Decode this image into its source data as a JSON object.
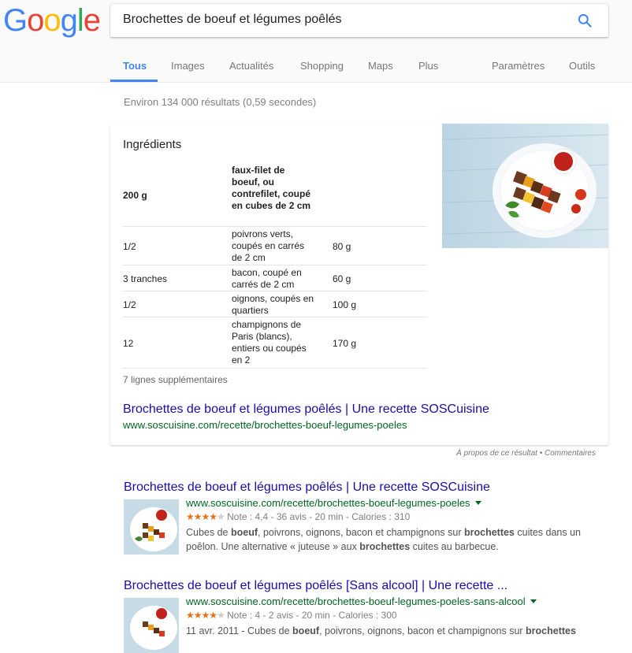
{
  "logo": {
    "letters": [
      "G",
      "o",
      "o",
      "g",
      "l",
      "e"
    ],
    "colors": [
      "#4285f4",
      "#ea4335",
      "#fbbc05",
      "#4285f4",
      "#34a853",
      "#ea4335"
    ]
  },
  "search": {
    "query": "Brochettes de boeuf et légumes poêlés"
  },
  "tabs": {
    "items": [
      {
        "label": "Tous"
      },
      {
        "label": "Images"
      },
      {
        "label": "Actualités"
      },
      {
        "label": "Shopping"
      },
      {
        "label": "Maps"
      },
      {
        "label": "Plus"
      },
      {
        "label": "Paramètres"
      },
      {
        "label": "Outils"
      }
    ]
  },
  "stats": "Environ 134 000 résultats (0,59 secondes)",
  "featured": {
    "title": "Ingrédients",
    "rows": [
      {
        "qty": "200 g",
        "name": "faux-filet de boeuf, ou contrefilet, coupé en cubes de 2 cm",
        "amount": ""
      },
      {
        "qty": "1/2",
        "name": "poivrons verts, coupés en carrés de 2 cm",
        "amount": "80 g"
      },
      {
        "qty": "3 tranches",
        "name": "bacon, coupé en carrés de 2 cm",
        "amount": "60 g"
      },
      {
        "qty": "1/2",
        "name": "oignons, coupés en quartiers",
        "amount": "100 g"
      },
      {
        "qty": "12",
        "name": "champignons de Paris (blancs), entiers ou coupés en 2",
        "amount": "170 g"
      }
    ],
    "more": "7 lignes supplémentaires",
    "link": "Brochettes de boeuf et légumes poêlés | Une recette SOSCuisine",
    "url": "www.soscuisine.com/recette/brochettes-boeuf-legumes-poeles"
  },
  "about": "À propos de ce résultat • Commentaires",
  "results": [
    {
      "title": "Brochettes de boeuf et légumes poêlés | Une recette SOSCuisine",
      "url": "www.soscuisine.com/recette/brochettes-boeuf-legumes-poeles",
      "rating_value": 4.4,
      "rating_text": "Note : 4,4 - 36 avis - 20 min - Calories : 310",
      "snippet_html": "Cubes de <b>boeuf</b>, poivrons, oignons, bacon et champignons sur <b>brochettes</b> cuites dans un poêlon. Une alternative « juteuse » aux <b>brochettes</b> cuites au barbecue."
    },
    {
      "title": "Brochettes de boeuf et légumes poêlés [Sans alcool] | Une recette ...",
      "url": "www.soscuisine.com/recette/brochettes-boeuf-legumes-poeles-sans-alcool",
      "rating_value": 4,
      "rating_text": "Note : 4 - 2 avis - 20 min - Calories : 300",
      "snippet_html": "11 avr. 2011 - Cubes de <b>boeuf</b>, poivrons, oignons, bacon et champignons sur <b>brochettes</b>"
    }
  ]
}
